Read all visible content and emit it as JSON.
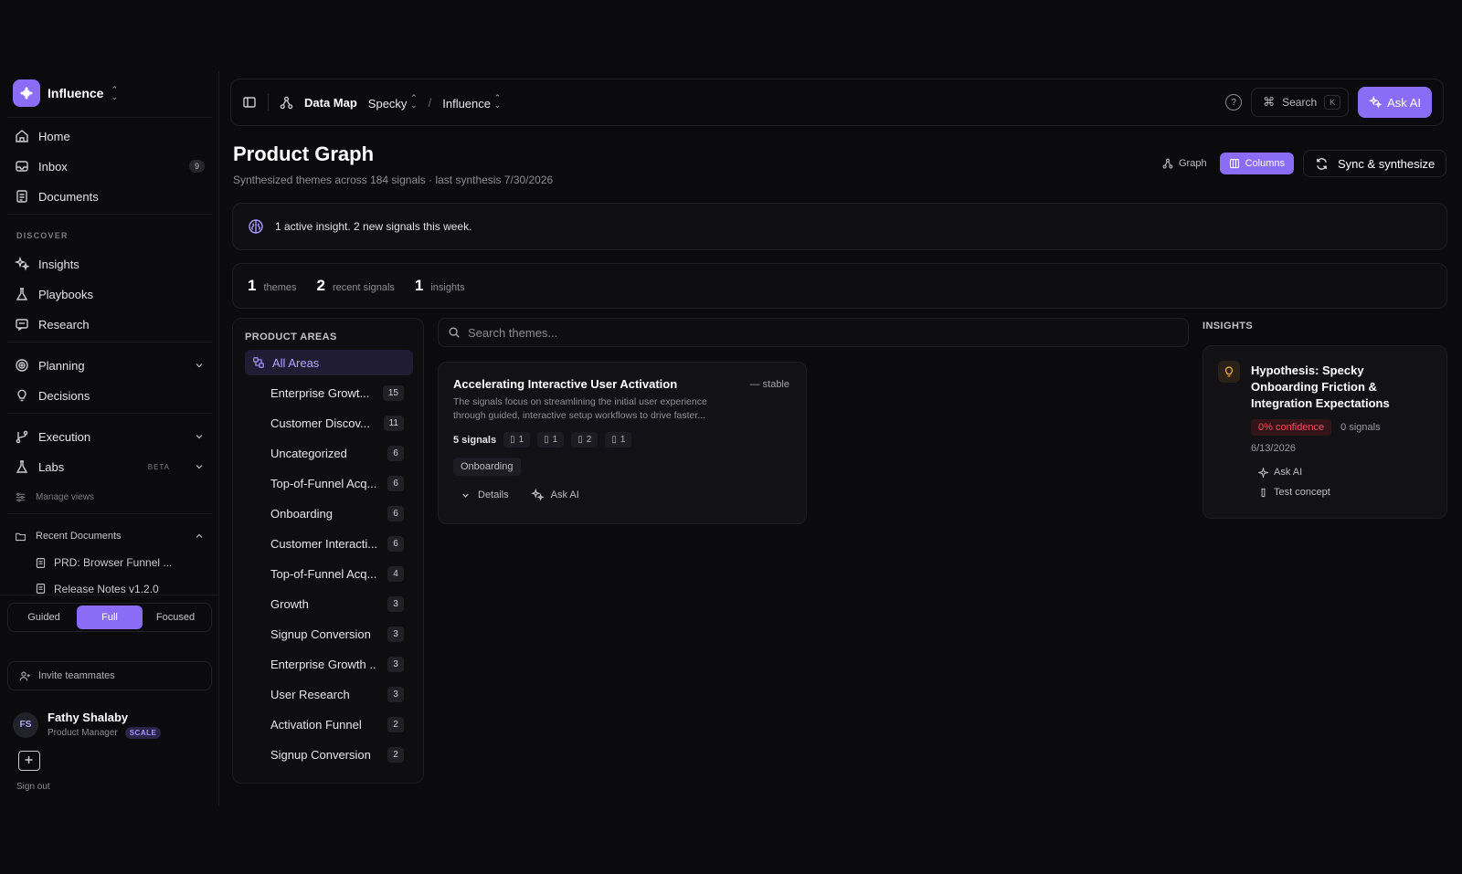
{
  "workspace": {
    "name": "Influence"
  },
  "nav": {
    "home": "Home",
    "inbox": "Inbox",
    "inbox_count": "9",
    "documents": "Documents",
    "discover_label": "DISCOVER",
    "insights": "Insights",
    "playbooks": "Playbooks",
    "research": "Research",
    "planning": "Planning",
    "decisions": "Decisions",
    "execution": "Execution",
    "labs": "Labs",
    "labs_badge": "BETA",
    "manage_views": "Manage views",
    "recent_documents": "Recent Documents",
    "recent_items": [
      "PRD: Browser Funnel ...",
      "Release Notes v1.2.0"
    ]
  },
  "mode_switch": {
    "options": [
      "Guided",
      "Full",
      "Focused"
    ],
    "selected": "Full"
  },
  "invite": "Invite teammates",
  "user": {
    "initials": "FS",
    "name": "Fathy Shalaby",
    "role": "Product Manager",
    "plan": "SCALE",
    "sign_out": "Sign out"
  },
  "topbar": {
    "section": "Data Map",
    "workspace": "Specky",
    "separator": "/",
    "project": "Influence",
    "help": "?",
    "search_label": "Search",
    "search_shortcut": "K",
    "ask_ai": "Ask AI"
  },
  "page": {
    "title": "Product Graph",
    "subtitle": "Synthesized themes across 184 signals · last synthesis 7/30/2026",
    "view_graph": "Graph",
    "view_columns": "Columns",
    "sync_button": "Sync & synthesize"
  },
  "banner": {
    "text": "1 active insight. 2 new signals this week."
  },
  "stats": [
    {
      "value": "1",
      "label": "themes"
    },
    {
      "value": "2",
      "label": "recent signals"
    },
    {
      "value": "1",
      "label": "insights"
    }
  ],
  "product_areas": {
    "heading": "PRODUCT AREAS",
    "all_label": "All Areas",
    "items": [
      {
        "name": "Enterprise Growt...",
        "count": "15"
      },
      {
        "name": "Customer Discov...",
        "count": "11"
      },
      {
        "name": "Uncategorized",
        "count": "6"
      },
      {
        "name": "Top-of-Funnel Acq...",
        "count": "6"
      },
      {
        "name": "Onboarding",
        "count": "6"
      },
      {
        "name": "Customer Interacti...",
        "count": "6"
      },
      {
        "name": "Top-of-Funnel Acq...",
        "count": "4"
      },
      {
        "name": "Growth",
        "count": "3"
      },
      {
        "name": "Signup Conversion",
        "count": "3"
      },
      {
        "name": "Enterprise Growth ...",
        "count": "3"
      },
      {
        "name": "User Research",
        "count": "3"
      },
      {
        "name": "Activation Funnel",
        "count": "2"
      },
      {
        "name": "Signup Conversion",
        "count": "2"
      }
    ]
  },
  "theme_search": {
    "placeholder": "Search themes..."
  },
  "theme_card": {
    "title": "Accelerating Interactive User Activation",
    "status": "stable",
    "description": "The signals focus on streamlining the initial user experience through guided, interactive setup workflows to drive faster...",
    "signals": "5 signals",
    "source_counts": [
      "1",
      "1",
      "2",
      "1"
    ],
    "tag": "Onboarding",
    "details": "Details",
    "ask_ai": "Ask AI"
  },
  "insights": {
    "heading": "INSIGHTS",
    "card": {
      "title": "Hypothesis: Specky Onboarding Friction & Integration Expectations",
      "confidence": "0% confidence",
      "signals": "0 signals",
      "date": "6/13/2026",
      "ask_ai": "Ask AI",
      "test_concept": "Test concept"
    }
  },
  "colors": {
    "accent": "#8b6cf6",
    "background": "#0b0b0d",
    "danger": "#ef4e5b"
  }
}
